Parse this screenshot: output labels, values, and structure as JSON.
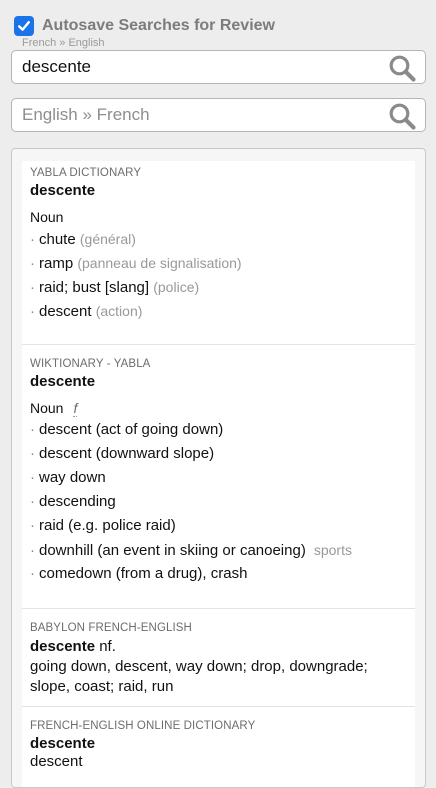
{
  "autosave": {
    "label": "Autosave Searches for Review",
    "checked": true
  },
  "search_fr_en": {
    "direction_label": "French » English",
    "value": "descente",
    "placeholder": ""
  },
  "search_en_fr": {
    "placeholder": "English » French",
    "value": ""
  },
  "colors": {
    "accent": "#1a73e8",
    "muted_text": "#999999",
    "background": "#ededed"
  },
  "entries": [
    {
      "source": "YABLA DICTIONARY",
      "headword": "descente",
      "pos": "Noun",
      "definitions": [
        {
          "text": "chute",
          "note": "(général)"
        },
        {
          "text": "ramp",
          "note": "(panneau de signalisation)"
        },
        {
          "text": "raid; bust [slang]",
          "note": "(police)"
        },
        {
          "text": "descent",
          "note": "(action)"
        }
      ]
    },
    {
      "source": "WIKTIONARY - YABLA",
      "headword": "descente",
      "pos": "Noun",
      "gender": "f",
      "definitions": [
        {
          "text": "descent (act of going down)"
        },
        {
          "text": "descent (downward slope)"
        },
        {
          "text": "way down"
        },
        {
          "text": "descending"
        },
        {
          "text": "raid (e.g. police raid)"
        },
        {
          "text": "downhill (an event in skiing or canoeing)",
          "tag": "sports"
        },
        {
          "text": "comedown (from a drug), crash"
        }
      ]
    },
    {
      "source": "BABYLON FRENCH-ENGLISH",
      "headword": "descente",
      "pos_inline": "nf.",
      "body": "going down, descent, way down; drop, downgrade; slope, coast; raid, run"
    },
    {
      "source": "FRENCH-ENGLISH ONLINE DICTIONARY",
      "headword": "descente",
      "body": "descent"
    }
  ]
}
